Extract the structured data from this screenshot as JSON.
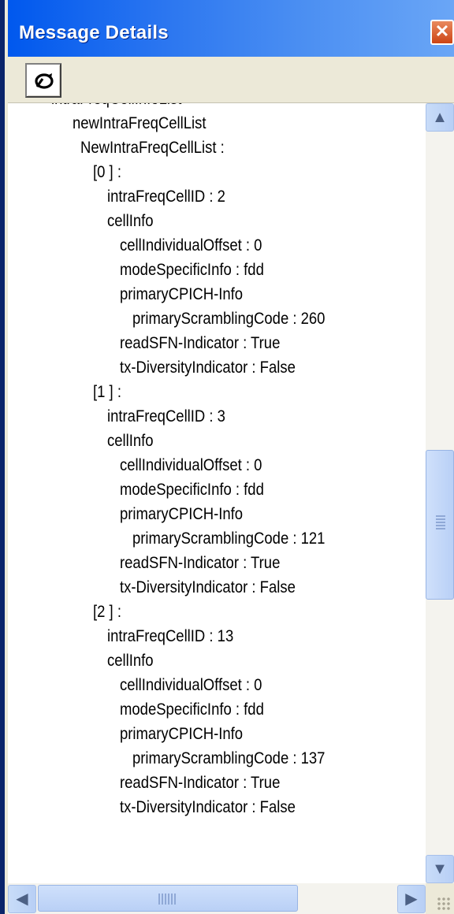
{
  "window": {
    "title": "Message Details",
    "close_label": "✕"
  },
  "toolbar": {
    "button_icon": "refresh-icon"
  },
  "scroll": {
    "up": "▲",
    "down": "▼",
    "left": "◀",
    "right": "▶"
  },
  "tree": [
    {
      "text": "intraFreqCellInfoList",
      "indent": 0,
      "partial": true
    },
    {
      "text": "newIntraFreqCellList",
      "indent": 1
    },
    {
      "text": "NewIntraFreqCellList :",
      "indent": 2
    },
    {
      "text": "[0 ] :",
      "indent": 3
    },
    {
      "text": "intraFreqCellID : 2",
      "indent": 4
    },
    {
      "text": "cellInfo",
      "indent": 4
    },
    {
      "text": "cellIndividualOffset : 0",
      "indent": 5
    },
    {
      "text": "modeSpecificInfo : fdd",
      "indent": 5
    },
    {
      "text": "primaryCPICH-Info",
      "indent": 5
    },
    {
      "text": "primaryScramblingCode : 260",
      "indent": 6
    },
    {
      "text": "readSFN-Indicator : True",
      "indent": 5
    },
    {
      "text": "tx-DiversityIndicator : False",
      "indent": 5
    },
    {
      "text": "[1 ] :",
      "indent": 3
    },
    {
      "text": "intraFreqCellID : 3",
      "indent": 4
    },
    {
      "text": "cellInfo",
      "indent": 4
    },
    {
      "text": "cellIndividualOffset : 0",
      "indent": 5
    },
    {
      "text": "modeSpecificInfo : fdd",
      "indent": 5
    },
    {
      "text": "primaryCPICH-Info",
      "indent": 5
    },
    {
      "text": "primaryScramblingCode : 121",
      "indent": 6
    },
    {
      "text": "readSFN-Indicator : True",
      "indent": 5
    },
    {
      "text": "tx-DiversityIndicator : False",
      "indent": 5
    },
    {
      "text": "[2 ] :",
      "indent": 3
    },
    {
      "text": "intraFreqCellID : 13",
      "indent": 4
    },
    {
      "text": "cellInfo",
      "indent": 4
    },
    {
      "text": "cellIndividualOffset : 0",
      "indent": 5
    },
    {
      "text": "modeSpecificInfo : fdd",
      "indent": 5
    },
    {
      "text": "primaryCPICH-Info",
      "indent": 5
    },
    {
      "text": "primaryScramblingCode : 137",
      "indent": 6
    },
    {
      "text": "readSFN-Indicator : True",
      "indent": 5
    },
    {
      "text": "tx-DiversityIndicator : False",
      "indent": 5,
      "partial": true
    }
  ]
}
